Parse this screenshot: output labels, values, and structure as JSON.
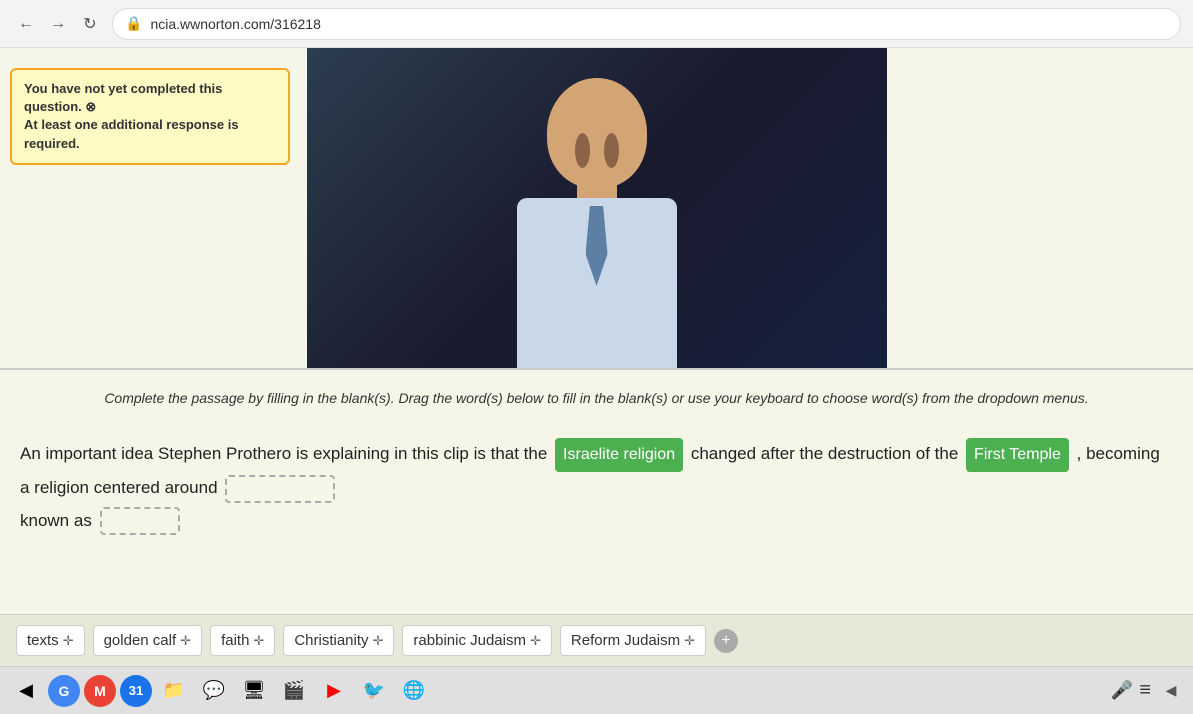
{
  "browser": {
    "url": "ncia.wwnorton.com/316218",
    "back_label": "←",
    "forward_label": "→",
    "refresh_label": "↻"
  },
  "warning": {
    "text": "You have not yet completed this question.\nAt least one additional response is required.",
    "close_label": "✕"
  },
  "instruction": {
    "text": "Complete the passage by filling in the blank(s). Drag the word(s) below to fill in the blank(s) or use your keyboard to choose word(s) from the dropdown menus."
  },
  "passage": {
    "part1": "An important idea Stephen Prothero is explaining in this clip is that the",
    "answer1": "Israelite religion",
    "part2": "changed after the destruction of the",
    "answer2": "First Temple",
    "part3": ", becoming a religion centered around",
    "blank1": "",
    "part4": "known as",
    "blank2": ""
  },
  "word_bank": {
    "words": [
      {
        "label": "texts",
        "has_icon": true
      },
      {
        "label": "golden calf",
        "has_icon": true
      },
      {
        "label": "faith",
        "has_icon": true
      },
      {
        "label": "Christianity",
        "has_icon": true
      },
      {
        "label": "rabbinic Judaism",
        "has_icon": true
      },
      {
        "label": "Reform Judaism",
        "has_icon": true
      }
    ],
    "add_label": "+"
  },
  "taskbar": {
    "items": [
      {
        "icon": "◀",
        "name": "back-nav"
      },
      {
        "icon": "●",
        "name": "chrome-icon",
        "color": "#4285f4"
      },
      {
        "icon": "M",
        "name": "gmail-icon",
        "color": "#ea4335"
      },
      {
        "icon": "31",
        "name": "calendar-icon",
        "color": "#1a73e8"
      },
      {
        "icon": "📁",
        "name": "files-icon"
      },
      {
        "icon": "💬",
        "name": "chat-icon",
        "color": "#1a73e8"
      },
      {
        "icon": "⬜",
        "name": "slides-icon"
      },
      {
        "icon": "▶",
        "name": "play-icon"
      },
      {
        "icon": "▶",
        "name": "youtube-icon",
        "color": "#ff0000"
      },
      {
        "icon": "🔄",
        "name": "refresh-icon"
      },
      {
        "icon": "🌐",
        "name": "web-icon"
      }
    ],
    "mic_icon": "🎤",
    "menu_icon": "≡"
  }
}
